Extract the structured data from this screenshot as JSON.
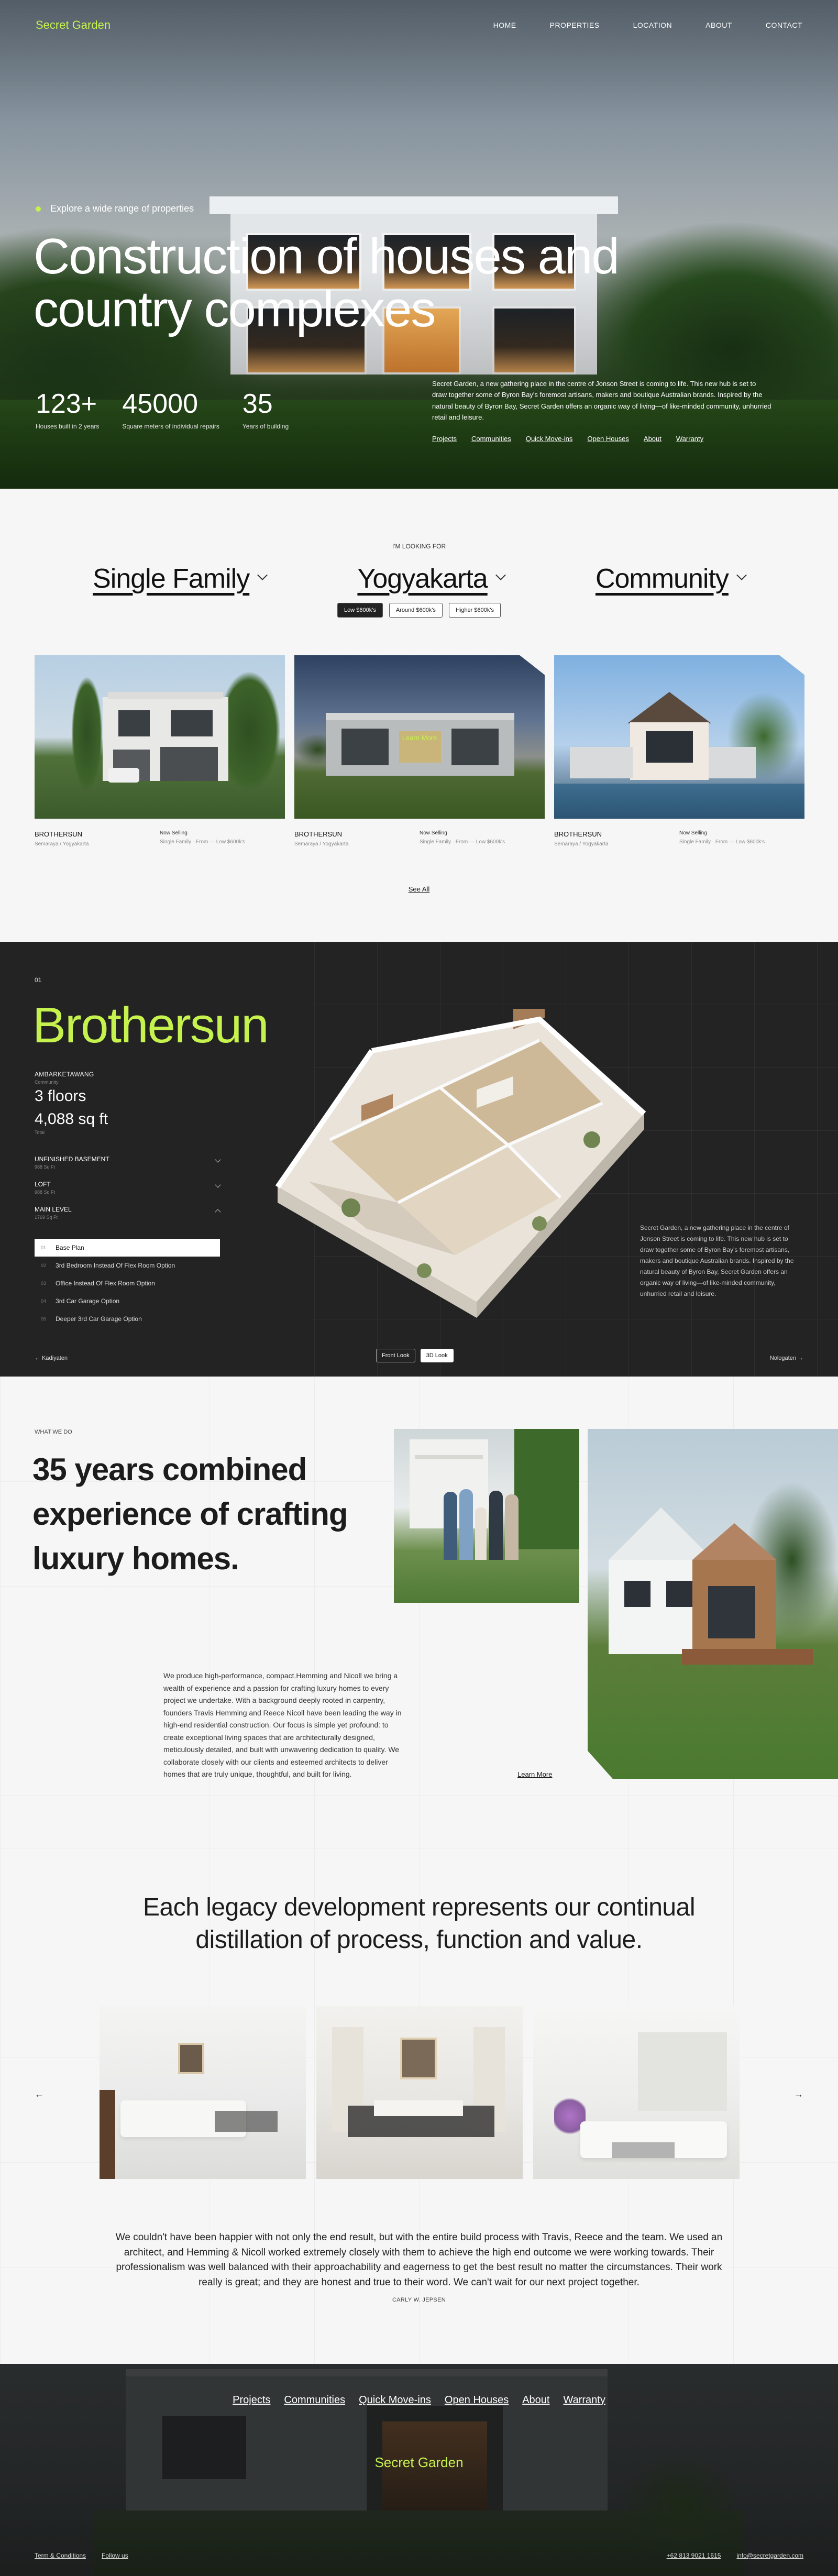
{
  "brand": {
    "name": "Secret Garden",
    "accent": "#c6f24e"
  },
  "nav": {
    "items": [
      "HOME",
      "PROPERTIES",
      "LOCATION",
      "ABOUT",
      "CONTACT"
    ]
  },
  "hero": {
    "tag": "Explore a wide range of properties",
    "title": "Construction of houses and country complexes",
    "stats": [
      {
        "num": "123+",
        "label": "Houses built in 2 years"
      },
      {
        "num": "45000",
        "label": "Square meters of individual repairs"
      },
      {
        "num": "35",
        "label": "Years of building"
      }
    ],
    "copy": "Secret Garden, a new gathering place in the centre of Jonson Street is coming to life. This new hub is set to draw together some of Byron Bay's foremost artisans, makers and boutique Australian brands. Inspired by the natural beauty of Byron Bay, Secret Garden offers an organic way of living—of like-minded community, unhurried retail and leisure.",
    "links": [
      "Projects",
      "Communities",
      "Quick Move-ins",
      "Open Houses",
      "About",
      "Warranty"
    ]
  },
  "search": {
    "eyebrow": "I'M LOOKING FOR",
    "filters": [
      "Single Family",
      "Yogyakarta",
      "Community"
    ],
    "prices": [
      "Low $600k's",
      "Around $600k's",
      "Higher $600k's"
    ],
    "active_price": 0,
    "cards": [
      {
        "name": "BROTHERSUN",
        "sub": "Semaraya / Yogyakarta",
        "tag": "Now Selling",
        "range": "Single Family · From — Low $600k's"
      },
      {
        "name": "BROTHERSUN",
        "sub": "Semaraya / Yogyakarta",
        "tag": "Now Selling",
        "range": "Single Family · From — Low $600k's",
        "hover_label": "Learn More"
      },
      {
        "name": "BROTHERSUN",
        "sub": "Semaraya / Yogyakarta",
        "tag": "Now Selling",
        "range": "Single Family · From — Low $600k's"
      }
    ],
    "see_all": "See All"
  },
  "model": {
    "index": "01",
    "title": "Brothersun",
    "community_label": "AMBARKETAWANG",
    "community_sub": "Community",
    "floors": "3 floors",
    "area": "4,088 sq ft",
    "area_sub": "Total",
    "accordions": [
      {
        "label": "UNFINISHED BASEMENT",
        "sub": "988 Sq Ft"
      },
      {
        "label": "LOFT",
        "sub": "988 Sq Ft"
      },
      {
        "label": "MAIN LEVEL",
        "sub": "1769 Sq Ft"
      }
    ],
    "options": [
      {
        "n": "01",
        "label": "Base Plan"
      },
      {
        "n": "02",
        "label": "3rd Bedroom Instead Of Flex Room Option"
      },
      {
        "n": "03",
        "label": "Office Instead Of Flex Room Option"
      },
      {
        "n": "04",
        "label": "3rd Car Garage Option"
      },
      {
        "n": "05",
        "label": "Deeper 3rd Car Garage Option"
      }
    ],
    "copy": "Secret Garden, a new gathering place in the centre of Jonson Street is coming to life. This new hub is set to draw together some of Byron Bay's foremost artisans, makers and boutique Australian brands. Inspired by the natural beauty of Byron Bay, Secret Garden offers an organic way of living—of like-minded community, unhurried retail and leisure.",
    "views": [
      "Front Look",
      "3D Look"
    ],
    "back": "Kadiyaten",
    "next": "Nologaten"
  },
  "about": {
    "eyebrow": "WHAT WE DO",
    "headline": "35 years combined experience of crafting luxury homes.",
    "body": "We produce high-performance, compact.Hemming and Nicoll we bring a wealth of experience and a passion for crafting luxury homes to every project we undertake. With a background deeply rooted in carpentry, founders Travis Hemming and Reece Nicoll have been leading the way in high-end residential construction. Our focus is simple yet profound: to create exceptional living spaces that are architecturally designed, meticulously detailed, and built with unwavering dedication to quality. We collaborate closely with our clients and esteemed architects to deliver homes that are truly unique, thoughtful, and built for living.",
    "learn": "Learn More"
  },
  "legacy": {
    "headline": "Each legacy development represents our continual distillation of process, function and value.",
    "quote": "We couldn't have been happier with not only the end result, but with the entire build process with Travis, Reece and the team. We used an architect, and Hemming & Nicoll worked extremely closely with them to achieve the high end outcome we were working towards. Their professionalism was well balanced with their approachability and eagerness to get the best result no matter the circumstances. Their work really is great; and they are honest and true to their word. We can't wait for our next project together.",
    "author": "CARLY W. JEPSEN",
    "prev": "←",
    "next": "→"
  },
  "footer": {
    "links": [
      "Projects",
      "Communities",
      "Quick Move-ins",
      "Open Houses",
      "About",
      "Warranty"
    ],
    "logo": "Secret Garden",
    "bottom_left": [
      "Term & Conditions",
      "Follow us"
    ],
    "phone": "+62 813 9021 1615",
    "email": "info@secretgarden.com"
  }
}
